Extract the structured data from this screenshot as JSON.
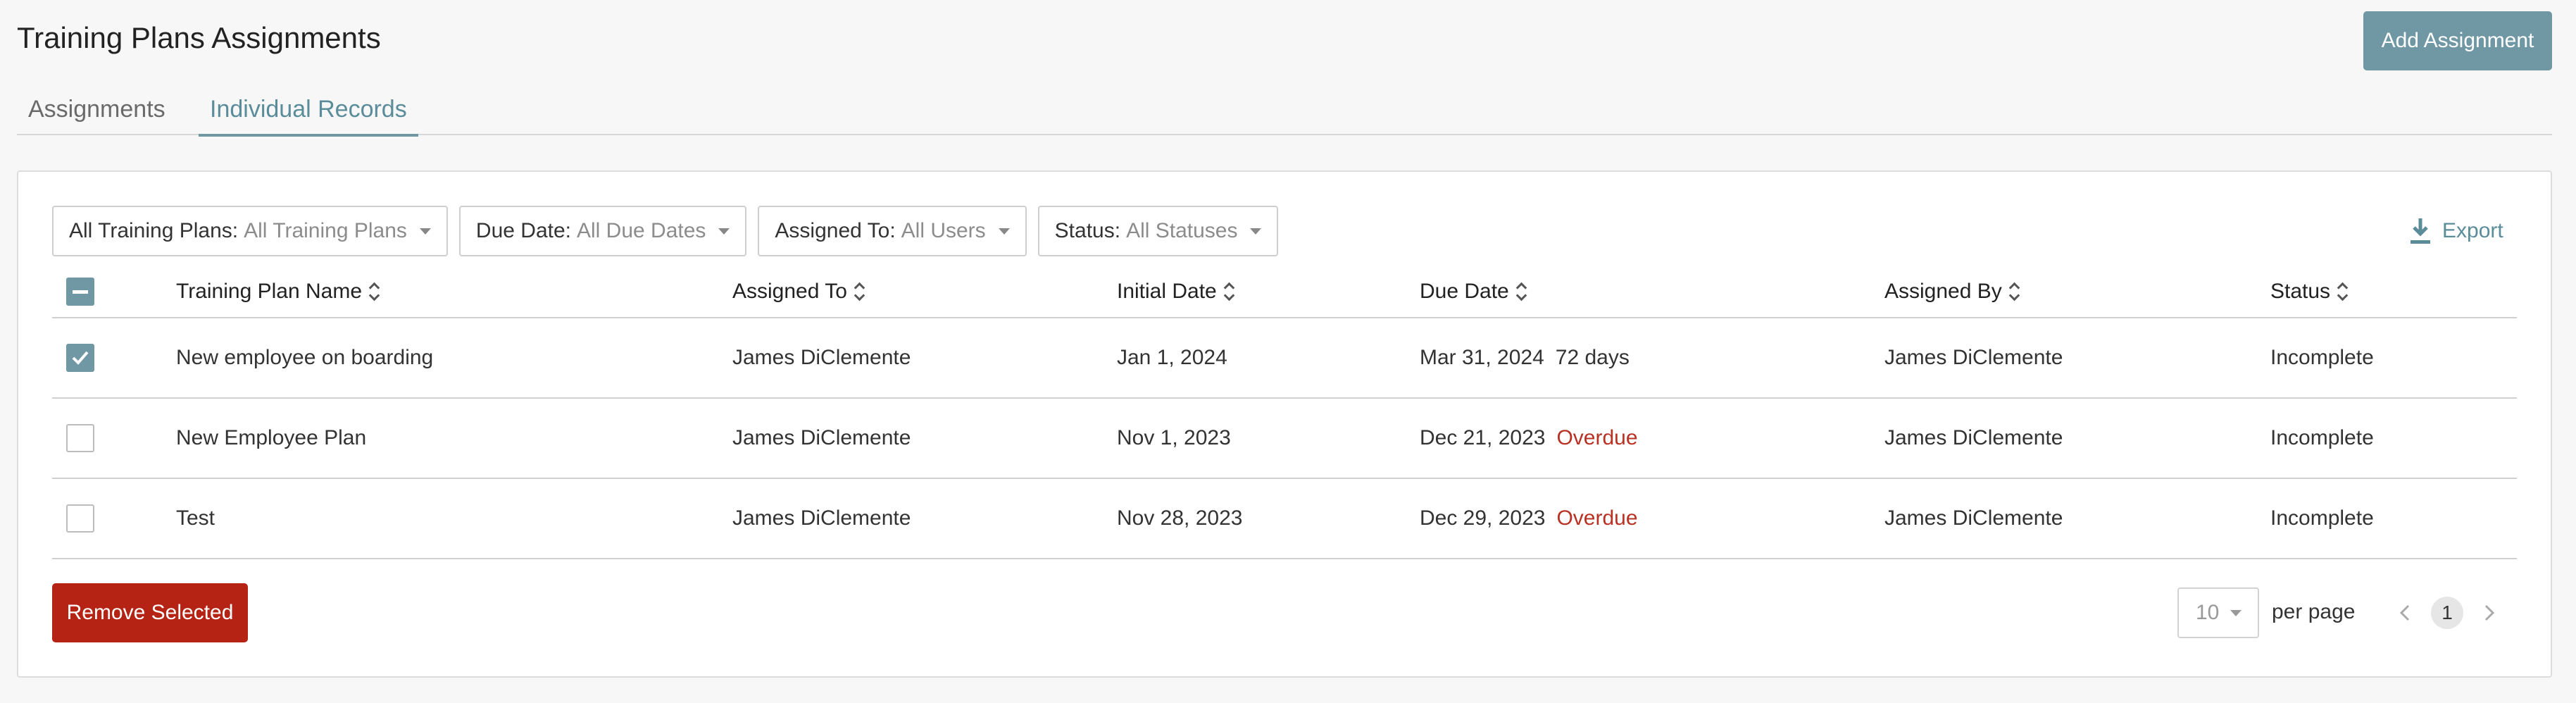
{
  "header": {
    "title": "Training Plans Assignments",
    "add_button": "Add Assignment"
  },
  "tabs": [
    {
      "label": "Assignments",
      "active": false
    },
    {
      "label": "Individual Records",
      "active": true
    }
  ],
  "filters": [
    {
      "label": "All Training Plans:",
      "value": "All Training Plans"
    },
    {
      "label": "Due Date:",
      "value": "All Due Dates"
    },
    {
      "label": "Assigned To:",
      "value": "All Users"
    },
    {
      "label": "Status:",
      "value": "All Statuses"
    }
  ],
  "export_label": "Export",
  "table": {
    "columns": [
      "Training Plan Name",
      "Assigned To",
      "Initial Date",
      "Due Date",
      "Assigned By",
      "Status"
    ],
    "select_all_state": "indeterminate",
    "rows": [
      {
        "checked": true,
        "name": "New employee on boarding",
        "assigned_to": "James DiClemente",
        "initial_date": "Jan 1, 2024",
        "due_date": "Mar 31, 2024",
        "due_note": "72 days",
        "due_overdue": false,
        "assigned_by": "James DiClemente",
        "status": "Incomplete"
      },
      {
        "checked": false,
        "name": "New Employee Plan",
        "assigned_to": "James DiClemente",
        "initial_date": "Nov 1, 2023",
        "due_date": "Dec 21, 2023",
        "due_note": "Overdue",
        "due_overdue": true,
        "assigned_by": "James DiClemente",
        "status": "Incomplete"
      },
      {
        "checked": false,
        "name": "Test",
        "assigned_to": "James DiClemente",
        "initial_date": "Nov 28, 2023",
        "due_date": "Dec 29, 2023",
        "due_note": "Overdue",
        "due_overdue": true,
        "assigned_by": "James DiClemente",
        "status": "Incomplete"
      }
    ]
  },
  "footer": {
    "remove_button": "Remove Selected",
    "per_page_value": "10",
    "per_page_label": "per page",
    "current_page": "1"
  },
  "colors": {
    "accent": "#6f98a4",
    "danger": "#b42313",
    "overdue": "#b83224"
  },
  "icons": {
    "export": "download-icon",
    "sort": "sort-icon",
    "prev": "chevron-left-icon",
    "next": "chevron-right-icon",
    "check": "check-icon"
  }
}
